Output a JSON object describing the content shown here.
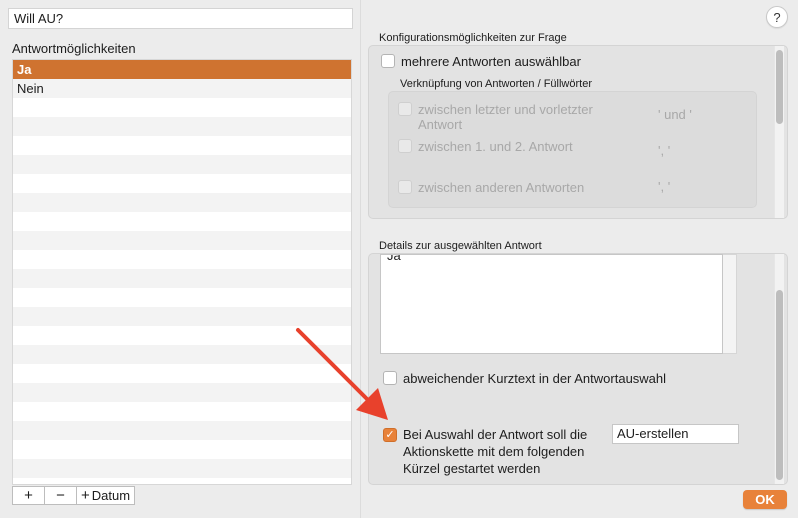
{
  "question": {
    "value": "Will AU?"
  },
  "help": {
    "label": "?"
  },
  "answers": {
    "label": "Antwortmöglichkeiten",
    "items": [
      "Ja",
      "Nein"
    ],
    "selected_index": 0,
    "toolbar": {
      "add": "+",
      "remove": "−",
      "date_symbol": "+",
      "date_label": "Datum"
    }
  },
  "config": {
    "title": "Konfigurationsmöglichkeiten zur Frage",
    "multi_label": "mehrere Antworten auswählbar",
    "link_title": "Verknüpfung von Antworten / Füllwörter",
    "links": [
      {
        "label_line1": "zwischen letzter und vorletzter",
        "label_line2": "Antwort",
        "value": "' und '"
      },
      {
        "label_line1": "zwischen 1. und 2. Antwort",
        "label_line2": "",
        "value": "', '"
      },
      {
        "label_line1": "zwischen anderen Antworten",
        "label_line2": "",
        "value": "', '"
      }
    ]
  },
  "details": {
    "title": "Details zur ausgewählten Antwort",
    "text": "Ja",
    "shorttext_label": "abweichender Kurztext in der Antwortauswahl",
    "action_line1": "Bei Auswahl der Antwort soll die",
    "action_line2": "Aktionskette mit dem folgenden",
    "action_line3": "Kürzel gestartet werden",
    "action_value": "AU-erstellen"
  },
  "footer": {
    "ok_label": "OK"
  },
  "colors": {
    "accent": "#e8823a",
    "selected_row": "#cf7330",
    "arrow": "#e8412c"
  }
}
